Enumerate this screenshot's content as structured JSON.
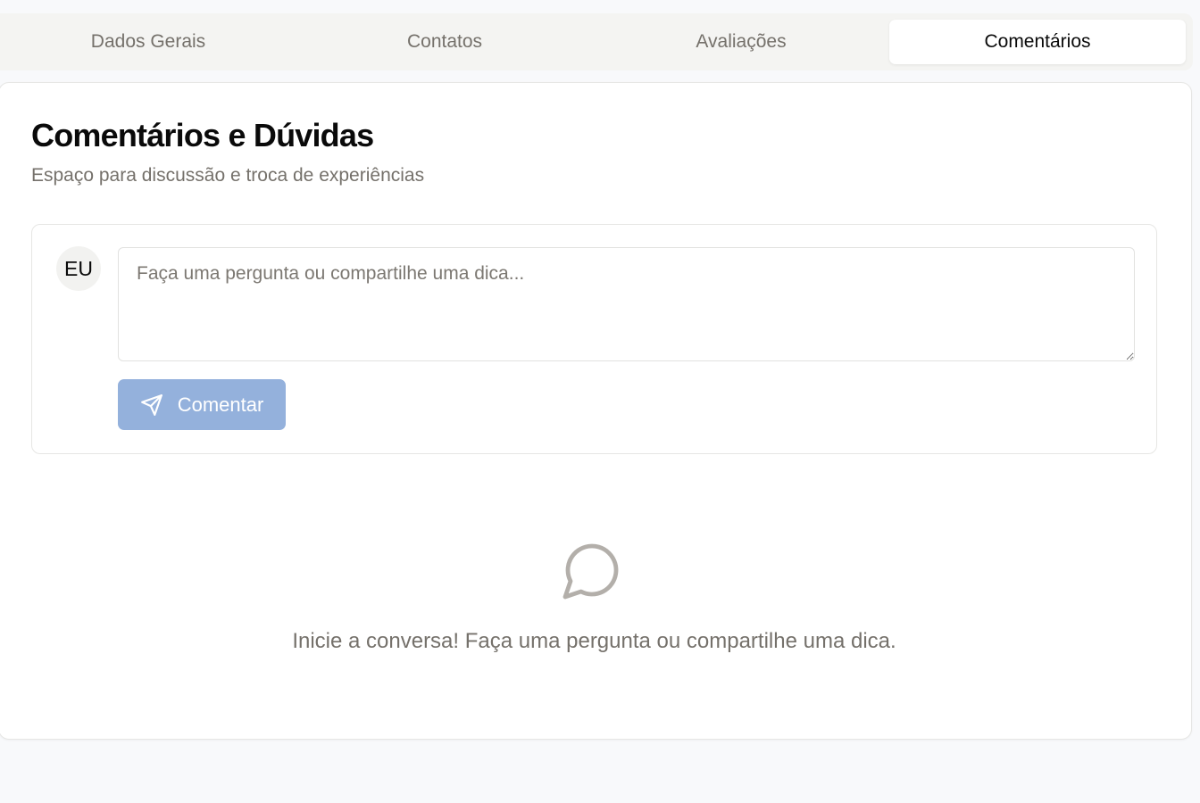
{
  "tabs": [
    {
      "label": "Dados Gerais",
      "active": false
    },
    {
      "label": "Contatos",
      "active": false
    },
    {
      "label": "Avaliações",
      "active": false
    },
    {
      "label": "Comentários",
      "active": true
    }
  ],
  "section": {
    "title": "Comentários e Dúvidas",
    "subtitle": "Espaço para discussão e troca de experiências"
  },
  "composer": {
    "avatar_initials": "EU",
    "placeholder": "Faça uma pergunta ou compartilhe uma dica...",
    "value": "",
    "submit_label": "Comentar",
    "submit_icon": "send-icon",
    "submit_disabled": true
  },
  "empty_state": {
    "icon": "message-circle-icon",
    "text": "Inicie a conversa! Faça uma pergunta ou compartilhe uma dica."
  },
  "colors": {
    "accent_disabled": "#94b1dc",
    "muted_text": "#75716b",
    "tab_bar_bg": "#f4f4f2"
  }
}
